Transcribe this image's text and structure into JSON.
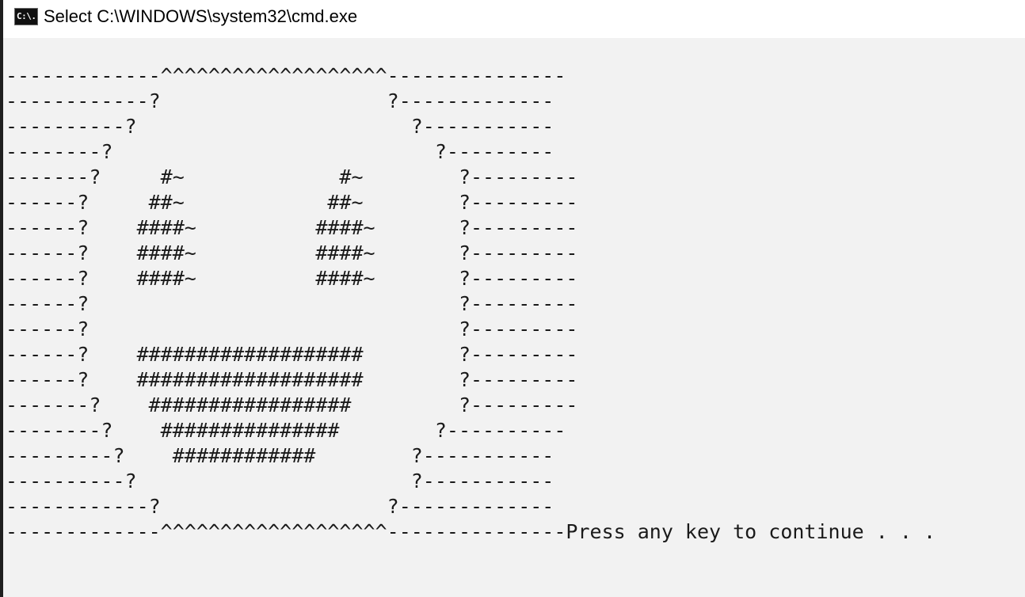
{
  "window": {
    "title": "Select C:\\WINDOWS\\system32\\cmd.exe",
    "icon": "cmd-console-icon",
    "icon_glyph": "C:\\."
  },
  "console": {
    "lines": [
      "-------------^^^^^^^^^^^^^^^^^^^---------------",
      "------------?                   ?-------------",
      "----------?                       ?-----------",
      "--------?                           ?---------",
      "-------?     #~             #~        ?---------",
      "------?     ##~            ##~        ?---------",
      "------?    ####~          ####~       ?---------",
      "------?    ####~          ####~       ?---------",
      "------?    ####~          ####~       ?---------",
      "------?                               ?---------",
      "------?                               ?---------",
      "------?    ###################        ?---------",
      "------?    ###################        ?---------",
      "-------?    #################         ?---------",
      "--------?    ###############        ?----------",
      "---------?    ############        ?-----------",
      "----------?                       ?-----------",
      "------------?                   ?-------------",
      "-------------^^^^^^^^^^^^^^^^^^^---------------Press any key to continue . . ."
    ]
  }
}
